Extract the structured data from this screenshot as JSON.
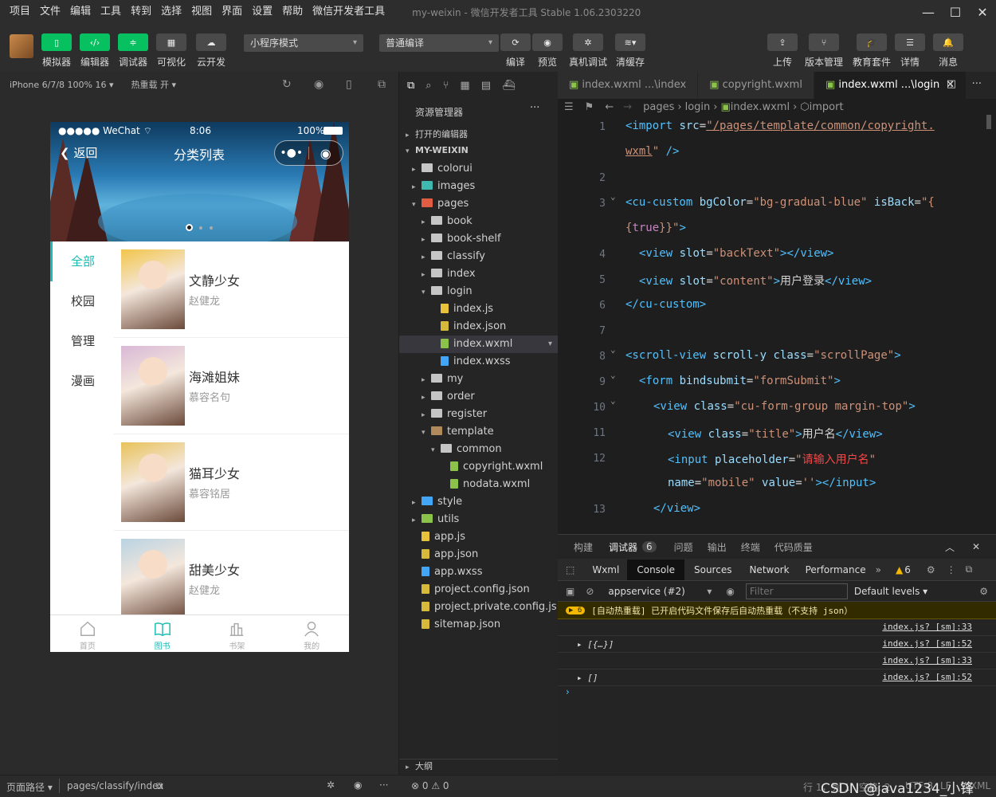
{
  "menu": [
    "项目",
    "文件",
    "编辑",
    "工具",
    "转到",
    "选择",
    "视图",
    "界面",
    "设置",
    "帮助",
    "微信开发者工具"
  ],
  "app_title": "my-weixin - 微信开发者工具 Stable 1.06.2303220",
  "toolbar": {
    "left_buttons": [
      "模拟器",
      "编辑器",
      "调试器",
      "可视化",
      "云开发"
    ],
    "mode_select": "小程序模式",
    "compile_select": "普通编译",
    "mid_buttons": [
      "编译",
      "预览",
      "真机调试",
      "清缓存"
    ],
    "right_buttons": [
      "上传",
      "版本管理",
      "教育套件",
      "详情",
      "消息"
    ]
  },
  "device": {
    "model": "iPhone 6/7/8 100% 16",
    "hot_reload": "热重载 开"
  },
  "phone": {
    "status_left": "●●●●● WeChat",
    "time": "8:06",
    "battery": "100%",
    "back_label": "返回",
    "nav_title": "分类列表",
    "categories": [
      "全部",
      "校园",
      "管理",
      "漫画"
    ],
    "books": [
      {
        "name": "文静少女",
        "author": "赵健龙",
        "color": "#f2c54a"
      },
      {
        "name": "海滩姐妹",
        "author": "慕容名句",
        "color": "#d9b8d6"
      },
      {
        "name": "猫耳少女",
        "author": "慕容铭居",
        "color": "#e8c25a"
      },
      {
        "name": "甜美少女",
        "author": "赵健龙",
        "color": "#b9d3e2"
      }
    ],
    "tabs": [
      "首页",
      "图书",
      "书架",
      "我的"
    ],
    "accent": "#1cbbb4"
  },
  "explorer": {
    "header": "资源管理器",
    "open_editors": "打开的编辑器",
    "project": "MY-WEIXIN",
    "files": [
      {
        "name": "colorui",
        "indent": 1,
        "arrow": "▸",
        "color": "#c5c5c5"
      },
      {
        "name": "images",
        "indent": 1,
        "arrow": "▸",
        "color": "#3fb8af"
      },
      {
        "name": "pages",
        "indent": 1,
        "arrow": "▾",
        "color": "#e05d44"
      },
      {
        "name": "book",
        "indent": 2,
        "arrow": "▸",
        "color": "#c5c5c5"
      },
      {
        "name": "book-shelf",
        "indent": 2,
        "arrow": "▸",
        "color": "#c5c5c5"
      },
      {
        "name": "classify",
        "indent": 2,
        "arrow": "▸",
        "color": "#c5c5c5"
      },
      {
        "name": "index",
        "indent": 2,
        "arrow": "▸",
        "color": "#c5c5c5"
      },
      {
        "name": "login",
        "indent": 2,
        "arrow": "▾",
        "color": "#c5c5c5"
      },
      {
        "name": "index.js",
        "indent": 3,
        "arrow": "",
        "color": "#e8c23a"
      },
      {
        "name": "index.json",
        "indent": 3,
        "arrow": "",
        "color": "#d7ba3a"
      },
      {
        "name": "index.wxml",
        "indent": 3,
        "arrow": "",
        "color": "#8bc34a"
      },
      {
        "name": "index.wxss",
        "indent": 3,
        "arrow": "",
        "color": "#42a5f5"
      },
      {
        "name": "my",
        "indent": 2,
        "arrow": "▸",
        "color": "#c5c5c5"
      },
      {
        "name": "order",
        "indent": 2,
        "arrow": "▸",
        "color": "#c5c5c5"
      },
      {
        "name": "register",
        "indent": 2,
        "arrow": "▸",
        "color": "#c5c5c5"
      },
      {
        "name": "template",
        "indent": 2,
        "arrow": "▾",
        "color": "#b08a5a"
      },
      {
        "name": "common",
        "indent": 3,
        "arrow": "▾",
        "color": "#c5c5c5"
      },
      {
        "name": "copyright.wxml",
        "indent": 4,
        "arrow": "",
        "color": "#8bc34a"
      },
      {
        "name": "nodata.wxml",
        "indent": 4,
        "arrow": "",
        "color": "#8bc34a"
      },
      {
        "name": "style",
        "indent": 1,
        "arrow": "▸",
        "color": "#42a5f5"
      },
      {
        "name": "utils",
        "indent": 1,
        "arrow": "▸",
        "color": "#8bc34a"
      },
      {
        "name": "app.js",
        "indent": 1,
        "arrow": "",
        "color": "#e8c23a"
      },
      {
        "name": "app.json",
        "indent": 1,
        "arrow": "",
        "color": "#d7ba3a"
      },
      {
        "name": "app.wxss",
        "indent": 1,
        "arrow": "",
        "color": "#42a5f5"
      },
      {
        "name": "project.config.json",
        "indent": 1,
        "arrow": "",
        "color": "#d7ba3a"
      },
      {
        "name": "project.private.config.js...",
        "indent": 1,
        "arrow": "",
        "color": "#d7ba3a"
      },
      {
        "name": "sitemap.json",
        "indent": 1,
        "arrow": "",
        "color": "#d7ba3a"
      }
    ],
    "outline": "大纲"
  },
  "editor": {
    "tabs": [
      "index.wxml ...\\index",
      "copyright.wxml",
      "index.wxml ...\\login"
    ],
    "breadcrumb": [
      "pages",
      "login",
      "index.wxml",
      "import"
    ]
  },
  "devtools": {
    "panel_tabs": [
      "构建",
      "调试器",
      "问题",
      "输出",
      "终端",
      "代码质量"
    ],
    "debugger_count": "6",
    "tabs": [
      "Wxml",
      "Console",
      "Sources",
      "Network",
      "Performance"
    ],
    "warn_count": "6",
    "context": "appservice (#2)",
    "filter_placeholder": "Filter",
    "levels": "Default levels",
    "warning_message": "[自动热重载] 已开启代码文件保存后自动热重载（不支持 json）",
    "warning_badge": "6",
    "lines": [
      {
        "text": "",
        "src": "index.js? [sm]:33"
      },
      {
        "text": "▸ [{…}]",
        "src": "index.js? [sm]:52"
      },
      {
        "text": "",
        "src": "index.js? [sm]:33"
      },
      {
        "text": "▸ []",
        "src": "index.js? [sm]:52"
      }
    ]
  },
  "status": {
    "page_path_label": "页面路径",
    "page_path": "pages/classify/index",
    "errors": "⊗ 0 ⚠ 0",
    "cursor": "行 1，列 1",
    "spaces": "空格: 2",
    "encoding": "UTF-8",
    "eol": "LF",
    "lang": "WXML",
    "watermark": "CSDN @java1234_小锋"
  }
}
